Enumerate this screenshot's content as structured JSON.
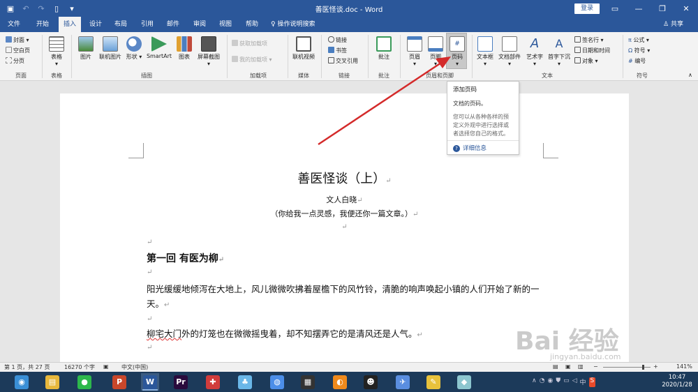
{
  "window": {
    "title": "善医怪谈.doc - Word",
    "login": "登录"
  },
  "tabs": [
    {
      "label": "文件"
    },
    {
      "label": "开始"
    },
    {
      "label": "插入"
    },
    {
      "label": "设计"
    },
    {
      "label": "布局"
    },
    {
      "label": "引用"
    },
    {
      "label": "邮件"
    },
    {
      "label": "审阅"
    },
    {
      "label": "视图"
    },
    {
      "label": "帮助"
    }
  ],
  "tell_me": "操作说明搜索",
  "share": "共享",
  "ribbon": {
    "pages": {
      "cover": "封面",
      "blank": "空白页",
      "break": "分页",
      "label": "页面"
    },
    "tables": {
      "table": "表格",
      "label": "表格"
    },
    "illustrations": {
      "pictures": "图片",
      "online_pictures": "联机图片",
      "shapes": "形状",
      "smartart": "SmartArt",
      "chart": "图表",
      "screenshot": "屏幕截图",
      "label": "插图"
    },
    "addins": {
      "get": "获取加载项",
      "my": "我的加载项",
      "label": "加载项"
    },
    "media": {
      "online_video": "联机视频",
      "label": "媒体"
    },
    "links": {
      "link": "链接",
      "bookmark": "书签",
      "cross_ref": "交叉引用",
      "label": "链接"
    },
    "comments": {
      "comment": "批注",
      "label": "批注"
    },
    "header_footer": {
      "header": "页眉",
      "footer": "页脚",
      "page_number": "页码",
      "label": "页眉和页脚"
    },
    "text": {
      "textbox": "文本框",
      "quickparts": "文档部件",
      "wordart": "艺术字",
      "dropcap": "首字下沉",
      "signature": "签名行",
      "datetime": "日期和时间",
      "object": "对象",
      "label": "文本"
    },
    "symbols": {
      "equation": "公式",
      "symbol": "符号",
      "number": "编号",
      "label": "符号"
    }
  },
  "tooltip": {
    "title": "添加页码",
    "desc": "文档的页码。",
    "more": "您可以从各种各样的预定义外观中进行选择或者选择您自己的格式。",
    "link": "详细信息"
  },
  "document": {
    "title": "善医怪谈（上）",
    "author": "文人白晓",
    "subtitle": "（你给我一点灵感，我便还你一篇文章。）",
    "pmark": "↵",
    "chapter": "第一回  有医为柳",
    "p1": "阳光缓缓地倾泻在大地上，风儿微微吹拂着屋檐下的风竹铃，清脆的响声唤起小镇的人们开始了新的一天。",
    "p2_pre": "柳宅大门",
    "p2_post": "外的灯笼也在微微摇曳着，却不知摆弄它的是清风还是人气。"
  },
  "status": {
    "page": "第 1 页，共 27 页",
    "words": "16270 个字",
    "lang": "中文(中国)",
    "zoom": "141%"
  },
  "taskbar": {
    "time": "10:47",
    "date": "2020/1/28",
    "apps": [
      {
        "name": "browser",
        "color": "#3a8fd6",
        "glyph": "◉"
      },
      {
        "name": "explorer",
        "color": "#e8b83c",
        "glyph": "▤"
      },
      {
        "name": "wechat",
        "color": "#2db84c",
        "glyph": "●"
      },
      {
        "name": "powerpoint",
        "color": "#c9472b",
        "glyph": "P"
      },
      {
        "name": "word",
        "color": "#2b579a",
        "glyph": "W"
      },
      {
        "name": "premiere",
        "color": "#2a0b3d",
        "glyph": "Pr"
      },
      {
        "name": "app-cross",
        "color": "#d13c3c",
        "glyph": "✚"
      },
      {
        "name": "app-pets",
        "color": "#6ab7e8",
        "glyph": "♣"
      },
      {
        "name": "chrome",
        "color": "#4c8ee8",
        "glyph": "◍"
      },
      {
        "name": "film",
        "color": "#333",
        "glyph": "▦"
      },
      {
        "name": "app-orange",
        "color": "#f08a1c",
        "glyph": "◐"
      },
      {
        "name": "qq",
        "color": "#222",
        "glyph": "☻"
      },
      {
        "name": "app-bird",
        "color": "#5a8ee0",
        "glyph": "✈"
      },
      {
        "name": "notes",
        "color": "#e8c23c",
        "glyph": "✎"
      },
      {
        "name": "app-cube",
        "color": "#8dc6cf",
        "glyph": "◆"
      }
    ]
  },
  "watermark": {
    "main": "Bai  经验",
    "sub": "jingyan.baidu.com"
  },
  "colors": {
    "accent": "#2b579a",
    "arrow": "#d42a2a"
  }
}
